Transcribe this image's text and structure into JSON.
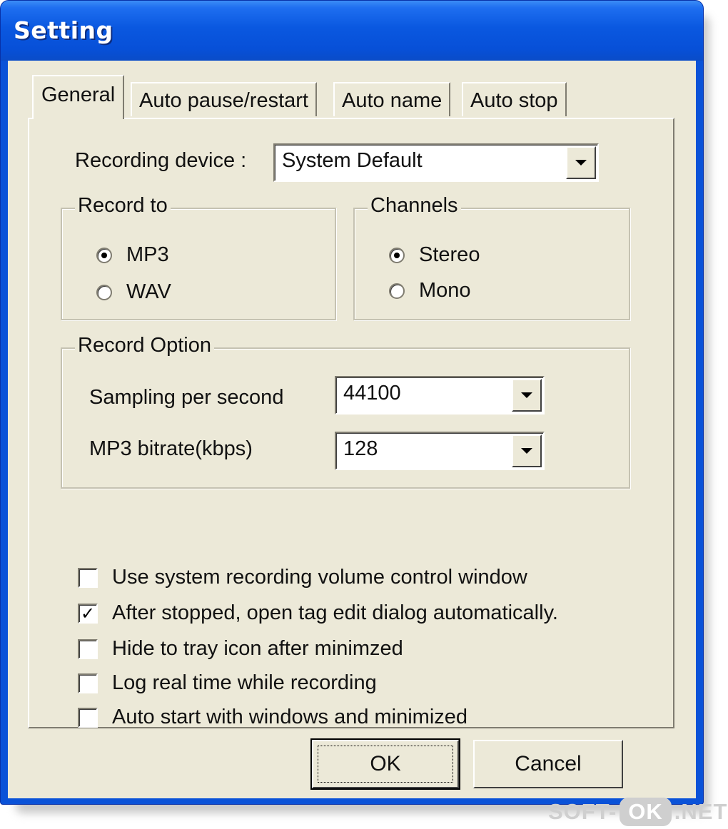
{
  "window": {
    "title": "Setting"
  },
  "tabs": [
    {
      "label": "General",
      "active": true
    },
    {
      "label": "Auto pause/restart",
      "active": false
    },
    {
      "label": "Auto name",
      "active": false
    },
    {
      "label": "Auto stop",
      "active": false
    }
  ],
  "general": {
    "recording_device": {
      "label": "Recording device :",
      "value": "System Default"
    },
    "record_to": {
      "legend": "Record to",
      "options": [
        {
          "label": "MP3",
          "selected": true
        },
        {
          "label": "WAV",
          "selected": false
        }
      ]
    },
    "channels": {
      "legend": "Channels",
      "options": [
        {
          "label": "Stereo",
          "selected": true
        },
        {
          "label": "Mono",
          "selected": false
        }
      ]
    },
    "record_option": {
      "legend": "Record Option",
      "sampling": {
        "label": "Sampling per second",
        "value": "44100"
      },
      "bitrate": {
        "label": "MP3 bitrate(kbps)",
        "value": "128"
      }
    },
    "checkboxes": [
      {
        "label": "Use system recording volume control window",
        "checked": false
      },
      {
        "label": "After stopped, open tag edit dialog automatically.",
        "checked": true
      },
      {
        "label": "Hide to tray icon after minimzed",
        "checked": false
      },
      {
        "label": "Log real time while recording",
        "checked": false
      },
      {
        "label": "Auto start with windows and  minimized",
        "checked": false
      }
    ]
  },
  "buttons": {
    "ok": "OK",
    "cancel": "Cancel"
  },
  "watermark": {
    "left": "SOFT-",
    "middle": "OK",
    "right": ".NET"
  }
}
